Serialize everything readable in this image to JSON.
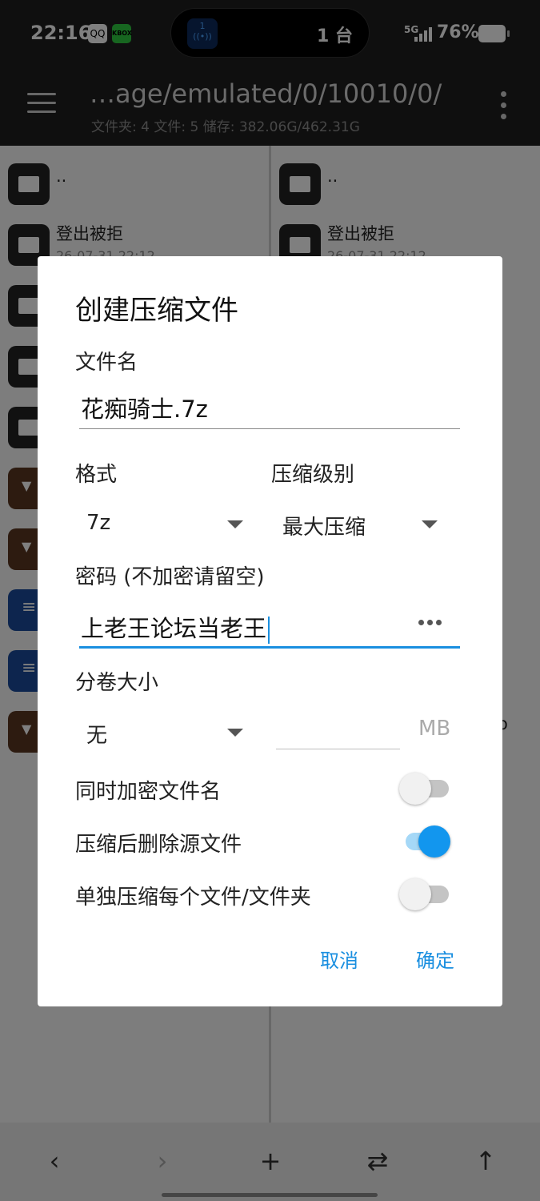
{
  "status_bar": {
    "time": "22:16",
    "app_badge_1": "QQ",
    "app_badge_2": "KBOX",
    "island_count": "1 台",
    "network": "5G",
    "battery": "76%"
  },
  "app_bar": {
    "path": "…age/emulated/0/10010/0/",
    "summary": "文件夹: 4   文件: 5   储存: 382.06G/462.31G"
  },
  "panes": {
    "left": [
      {
        "name": "..",
        "date": "",
        "kind": "folder"
      },
      {
        "name": "登出被拒",
        "date": "26-07-31 22:12",
        "kind": "folder"
      },
      {
        "name": "",
        "date": "",
        "kind": "folder"
      },
      {
        "name": "",
        "date": "",
        "kind": "folder"
      },
      {
        "name": "",
        "date": "",
        "kind": "folder"
      },
      {
        "name": "",
        "date": "",
        "kind": "archive"
      },
      {
        "name": "",
        "date": "",
        "kind": "archive"
      },
      {
        "name": "",
        "date": "",
        "kind": "doc"
      },
      {
        "name": "",
        "date": "",
        "kind": "doc"
      },
      {
        "name": "",
        "date": "",
        "kind": "archive"
      }
    ],
    "right": [
      {
        "name": "..",
        "date": "",
        "kind": "folder"
      },
      {
        "name": "登出被拒",
        "date": "26-07-31 22:12",
        "kind": "folder"
      }
    ],
    "right_partial_text": "o"
  },
  "dialog": {
    "title": "创建压缩文件",
    "filename_label": "文件名",
    "filename_value": "花痴骑士.7z",
    "format_label": "格式",
    "format_value": "7z",
    "level_label": "压缩级别",
    "level_value": "最大压缩",
    "password_label": "密码 (不加密请留空)",
    "password_value": "上老王论坛当老王",
    "volume_label": "分卷大小",
    "volume_value": "无",
    "volume_unit": "MB",
    "toggles": [
      {
        "label": "同时加密文件名",
        "on": false
      },
      {
        "label": "压缩后删除源文件",
        "on": true
      },
      {
        "label": "单独压缩每个文件/文件夹",
        "on": false
      }
    ],
    "cancel": "取消",
    "confirm": "确定"
  },
  "toolbar": {
    "back": "‹",
    "forward": "›",
    "add": "+",
    "swap": "⇄",
    "up": "↑"
  },
  "colors": {
    "accent": "#1a8fe0",
    "switch_on": "#1296ee",
    "bar_dark": "#1e1e1e"
  }
}
